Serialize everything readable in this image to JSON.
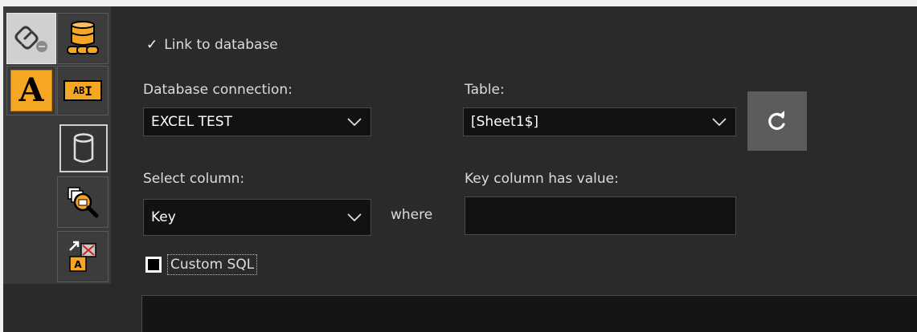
{
  "toolbar": {
    "items": [
      {
        "icon": "link-icon",
        "active": true
      },
      {
        "icon": "database-link-icon"
      },
      {
        "icon": "text-A-icon"
      },
      {
        "icon": "text-field-icon",
        "text": "AB"
      },
      {
        "icon": "database-icon",
        "selected": true
      },
      {
        "icon": "database-search-icon"
      },
      {
        "icon": "field-mapping-icon"
      }
    ]
  },
  "link": {
    "checkmark": "✓",
    "label": "Link to database"
  },
  "db_connection": {
    "label": "Database connection:",
    "value": "EXCEL TEST"
  },
  "table": {
    "label": "Table:",
    "value": "[Sheet1$]"
  },
  "refresh": {
    "icon": "refresh-icon"
  },
  "select_column": {
    "label": "Select column:",
    "value": "Key"
  },
  "where_text": "where",
  "key_value": {
    "label": "Key column has value:",
    "value": ""
  },
  "custom_sql": {
    "label": "Custom SQL",
    "checked": false
  },
  "sql_text": "",
  "colors": {
    "panel_bg": "#2a2a2a",
    "accent_orange": "#f5a623",
    "field_bg": "#121212"
  }
}
